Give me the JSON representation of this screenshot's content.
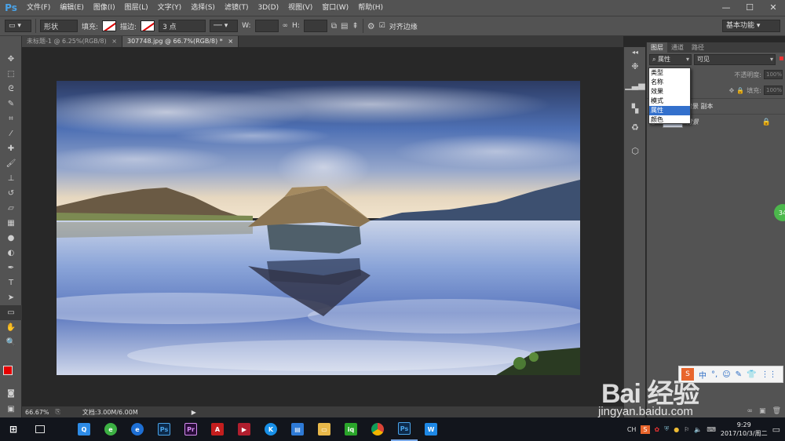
{
  "app": {
    "logo": "Ps"
  },
  "menu": [
    "文件(F)",
    "编辑(E)",
    "图像(I)",
    "图层(L)",
    "文字(Y)",
    "选择(S)",
    "滤镜(T)",
    "3D(D)",
    "视图(V)",
    "窗口(W)",
    "帮助(H)"
  ],
  "window_controls": {
    "minimize": "—",
    "maximize": "☐",
    "close": "✕"
  },
  "options": {
    "mode": "形状",
    "fill_label": "填充:",
    "stroke_label": "描边:",
    "stroke_size": "3 点",
    "w_label": "W:",
    "h_label": "H:",
    "align_edges_label": "对齐边缘",
    "align_edges_checked": true,
    "workspace": "基本功能"
  },
  "tabs": [
    {
      "label": "未标题-1 @ 6.25%(RGB/8)",
      "close": "×",
      "active": false
    },
    {
      "label": "307748.jpg @ 66.7%(RGB/8) *",
      "close": "×",
      "active": true
    }
  ],
  "status": {
    "zoom": "66.67%",
    "doc": "文档:3.00M/6.00M"
  },
  "layers_panel": {
    "tabs": [
      "图层",
      "通道",
      "路径"
    ],
    "filter_type": "属性",
    "filter_value": "可见",
    "opacity_label": "不透明度:",
    "opacity_value": "100%",
    "fill_label": "填充:",
    "fill_value": "100%",
    "layers": [
      {
        "name": "背景 副本",
        "selected": false,
        "locked": false
      },
      {
        "name": "背景",
        "selected": false,
        "locked": true
      }
    ]
  },
  "filter_dropdown": {
    "items": [
      "类型",
      "名称",
      "效果",
      "模式",
      "属性",
      "颜色"
    ],
    "selected": "属性"
  },
  "watermark": {
    "brand": "Bai 经验",
    "url": "jingyan.baidu.com"
  },
  "side_badge": "34",
  "taskbar": {
    "clock_time": "9:29",
    "clock_date": "2017/10/3/周二",
    "ime_lang": "CH",
    "ime_bar_label": "中"
  },
  "colors": {
    "accent": "#3370cc",
    "foreground": "#e60000",
    "background": "#ffffff"
  }
}
